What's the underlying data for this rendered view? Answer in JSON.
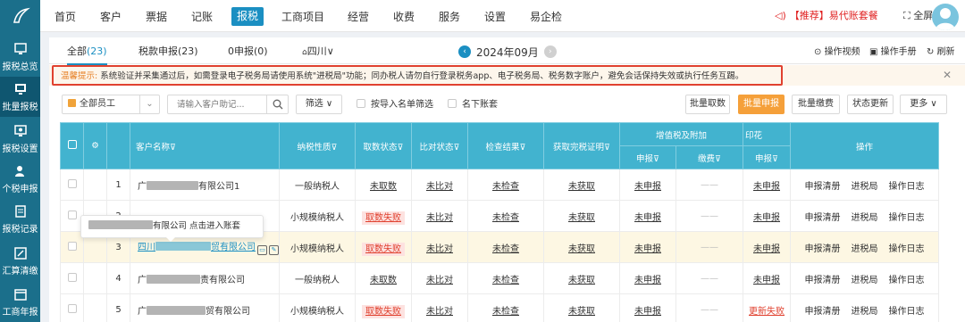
{
  "sidebar": {
    "items": [
      {
        "label": "报税总览",
        "icon": "overview-icon"
      },
      {
        "label": "批量报税",
        "icon": "batch-tax-icon"
      },
      {
        "label": "报税设置",
        "icon": "settings-icon"
      },
      {
        "label": "个税申报",
        "icon": "person-tax-icon"
      },
      {
        "label": "报税记录",
        "icon": "record-icon"
      },
      {
        "label": "汇算清缴",
        "icon": "settlement-icon"
      },
      {
        "label": "工商年报",
        "icon": "annual-report-icon"
      }
    ]
  },
  "topnav": {
    "items": [
      "首页",
      "客户",
      "票据",
      "记账",
      "报税",
      "工商项目",
      "经营",
      "收费",
      "服务",
      "设置",
      "易企检"
    ],
    "active": "报税",
    "promo": "【推荐】易代账套餐",
    "fullscreen": "全屏"
  },
  "tabs": [
    {
      "label": "全部",
      "count": "(23)"
    },
    {
      "label": "税款申报(23)",
      "count": ""
    },
    {
      "label": "0申报(0)",
      "count": ""
    }
  ],
  "region": "四川",
  "period": "2024年09月",
  "top_links": {
    "video": "操作视频",
    "manual": "操作手册",
    "refresh": "刷新"
  },
  "notice": {
    "label": "温馨提示:",
    "text": "系统验证并采集通过后，如需登录电子税务局请使用系统\"进税局\"功能；同办税人请勿自行登录税务app、电子税务局、税务数字账户，避免会话保持失效或执行任务互踢。"
  },
  "filters": {
    "staff": "全部员工",
    "search_placeholder": "请输入客户助记...",
    "filter_btn": "筛选",
    "import_chk": "按导入名单筛选",
    "below_chk": "名下账套"
  },
  "actions": {
    "fetch": "批量取数",
    "declare": "批量申报",
    "pay": "批量缴费",
    "status": "状态更新",
    "more": "更多"
  },
  "table": {
    "headers": {
      "name": "客户名称",
      "nature": "纳税性质",
      "fetch": "取数状态",
      "compare": "比对状态",
      "check": "检查结果",
      "cert": "获取完税证明",
      "vat_group": "增值税及附加",
      "declare": "申报",
      "pay": "缴费",
      "stamp_group": "印花",
      "stamp_declare": "申报",
      "ops": "操作"
    },
    "rows": [
      {
        "no": "1",
        "name_pre": "广",
        "name_post": "有限公司1",
        "nature": "一般纳税人",
        "fetch": "未取数",
        "compare": "未比对",
        "check": "未检查",
        "cert": "未获取",
        "vat_declare": "未申报",
        "vat_pay": "——",
        "stamp": "未申报",
        "op1": "申报清册",
        "op2": "进税局",
        "op3": "操作日志"
      },
      {
        "no": "2",
        "name_pre": "",
        "name_post": "",
        "nature": "小规模纳税人",
        "fetch": "取数失败",
        "compare": "未比对",
        "check": "未检查",
        "cert": "未获取",
        "vat_declare": "未申报",
        "vat_pay": "——",
        "stamp": "未申报",
        "op1": "申报清册",
        "op2": "进税局",
        "op3": "操作日志"
      },
      {
        "no": "3",
        "name_pre": "四川",
        "name_post": "贸有限公司",
        "nature": "小规模纳税人",
        "fetch": "取数失败",
        "compare": "未比对",
        "check": "未检查",
        "cert": "未获取",
        "vat_declare": "未申报",
        "vat_pay": "——",
        "stamp": "未申报",
        "op1": "申报清册",
        "op2": "进税局",
        "op3": "操作日志"
      },
      {
        "no": "4",
        "name_pre": "广",
        "name_post": "责有限公司",
        "nature": "一般纳税人",
        "fetch": "未取数",
        "compare": "未比对",
        "check": "未检查",
        "cert": "未获取",
        "vat_declare": "未申报",
        "vat_pay": "——",
        "stamp": "未申报",
        "op1": "申报清册",
        "op2": "进税局",
        "op3": "操作日志"
      },
      {
        "no": "5",
        "name_pre": "广",
        "name_post": "贸有限公司",
        "nature": "小规模纳税人",
        "fetch": "取数失败",
        "compare": "未比对",
        "check": "未检查",
        "cert": "未获取",
        "vat_declare": "未申报",
        "vat_pay": "——",
        "stamp": "更新失败",
        "op1": "申报清册",
        "op2": "进税局",
        "op3": "操作日志"
      }
    ]
  },
  "tooltip": {
    "company": "有限公司",
    "action": "点击进入账套"
  },
  "colors": {
    "sidebar": "#1b6f8b",
    "accent": "#1b8fc2",
    "header": "#42b3cf",
    "primary_btn": "#f5a03a",
    "error": "#e0412f"
  }
}
